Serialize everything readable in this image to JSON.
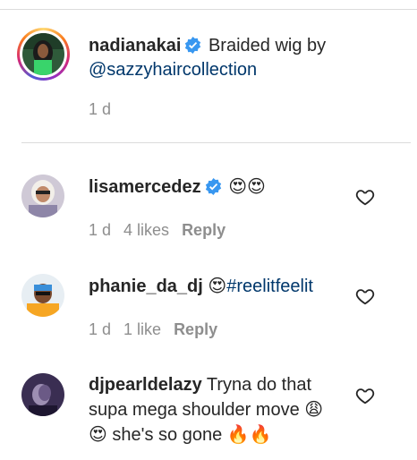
{
  "caption": {
    "username": "nadianakai",
    "text": "Braided wig by",
    "mention": "@sazzyhaircollection",
    "time": "1 d"
  },
  "comments": [
    {
      "username": "lisamercedez",
      "verified": true,
      "text_emoji": "😍😍",
      "time": "1 d",
      "likes": "4 likes",
      "reply_label": "Reply"
    },
    {
      "username": "phanie_da_dj",
      "text_emoji": "😍",
      "hashtag": "#reelitfeelit",
      "time": "1 d",
      "likes": "1 like",
      "reply_label": "Reply"
    },
    {
      "username": "djpearldelazy",
      "text": "Tryna do that supa mega shoulder move",
      "emoji_a": "😩😍",
      "text_b": "she's so gone",
      "emoji_b": "🔥🔥"
    }
  ],
  "colors": {
    "verified": "#3897f0",
    "link": "#00376b",
    "muted": "#8e8e8e"
  }
}
